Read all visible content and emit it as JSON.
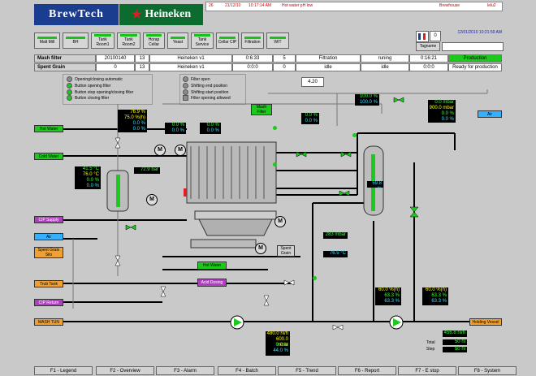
{
  "header": {
    "brand_left": "BrewTech",
    "brand_right": "Heineken"
  },
  "alarm": {
    "id": "26",
    "date": "21/12/10",
    "time": "10:17:14 AM",
    "text": "Hot water pH low",
    "area": "Brewhouse",
    "user": "lelu2"
  },
  "clock": "12/01/2010 10:21:59 AM",
  "tagname": "Tagname",
  "counter": "0",
  "nav": [
    {
      "label": "Malt Mill"
    },
    {
      "label": "BH"
    },
    {
      "label": "Tank Room1"
    },
    {
      "label": "Tank Room2"
    },
    {
      "label": "Horap Cellar"
    },
    {
      "label": "Yeast"
    },
    {
      "label": "Tank Service"
    },
    {
      "label": "Cellar CIP"
    },
    {
      "label": "Filtration"
    },
    {
      "label": "WIT"
    }
  ],
  "rows": [
    {
      "name": "Mash filter",
      "batch": "20100140",
      "num": "13",
      "brand": "Heineken v1",
      "time1": "0:6:33",
      "step": "5",
      "phase": "Filtration",
      "state": "runing",
      "time2": "0:16:21",
      "status": "Production"
    },
    {
      "name": "Spent Grain",
      "batch": "0",
      "num": "13",
      "brand": "Heineken v1",
      "time1": "0:0:0",
      "step": "0",
      "phase": "idle",
      "state": "idle",
      "time2": "0:0:0",
      "status": "Ready for production"
    }
  ],
  "legend_left": [
    "Opening/closing automatic",
    "Button opening filter",
    "Button stop opening/closing filter",
    "Button closing filter"
  ],
  "legend_right": [
    "Filter open",
    "Shifting end position",
    "Shifting start position",
    "Filter opening allowed"
  ],
  "value_box": "4.20",
  "tags": {
    "hot_water": "Hot Water",
    "cold_water": "Cold Water",
    "cip_supply": "CIP Supply",
    "air": "Air",
    "spent_grain_silo": "Spent Grain Silo",
    "trub_tank": "Trub Tank",
    "cip_return": "CIP Return",
    "mash_tun": "MASH TUN",
    "hot_water2": "Hot Water",
    "acid_dosing": "Acid Dosing",
    "mash_filter": "Mash Filter",
    "spent_grain": "Spent Grain",
    "air_right": "Air",
    "holding_vessel": "Holding Vessel"
  },
  "displays": {
    "d1": [
      "76.9 %",
      "75.0 %(h)",
      "0.0 %",
      "0.0 %"
    ],
    "d2": [
      "0.0 %",
      "0.0 %"
    ],
    "d3": [
      "0.0 %",
      "0.0 %"
    ],
    "d4": [
      "41.5 °C",
      "76.0 °C",
      "0.0 %",
      "0.0 %"
    ],
    "bar": "72.9 bar",
    "d5": [
      "0.0 %",
      "0.0 %"
    ],
    "d6": [
      "100.0 %",
      "100.0 %"
    ],
    "d7": [
      "0.0 mbar",
      "900.0 mbar",
      "0.0 %",
      "0.0 %"
    ],
    "level": "59.8 %",
    "mbar": "283 mbar",
    "temp": "76.5 °C",
    "d8": [
      "60.0 %(h)",
      "63.3 %",
      "63.3 %"
    ],
    "d9": [
      "60.0 %(h)",
      "63.3 %",
      "63.3 %"
    ],
    "flow": [
      "480.0 hl/h",
      "600.0 mbar",
      "0.0 %",
      "44.0 %"
    ],
    "total": "456.8 hl/h",
    "total_val1": "50",
    "total_val2": "50",
    "total_lbl": "Total",
    "step_lbl": "Step",
    "unit": "hl"
  },
  "fkeys": [
    "F1 - Legend",
    "F2 - Overview",
    "F3 - Alarm",
    "F4 - Batch",
    "F5 - Trend",
    "F6 - Report",
    "F7 - E stop",
    "F8 - System"
  ],
  "motor_label": "M"
}
